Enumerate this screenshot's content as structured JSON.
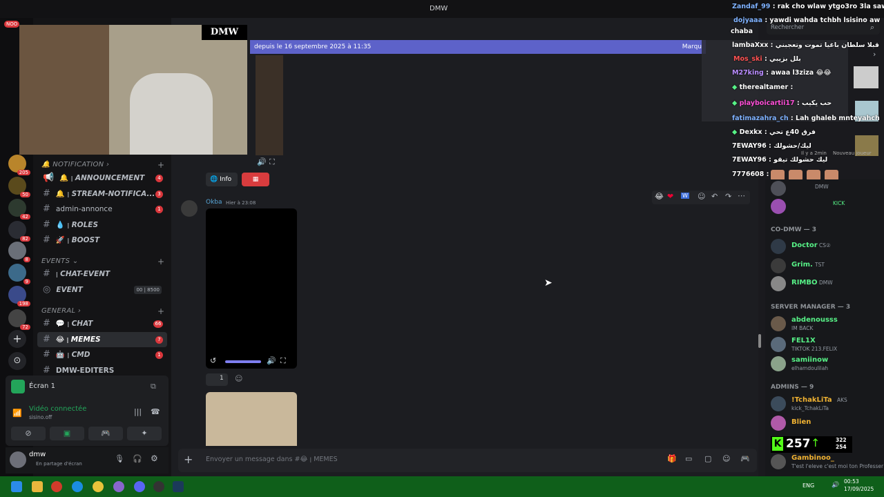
{
  "window": {
    "title": "DMW"
  },
  "overlay_logo": "DMW",
  "notif_badge": "NOO",
  "servers": [
    {
      "badge": ""
    },
    {
      "badge": "205"
    },
    {
      "badge": "50"
    },
    {
      "badge": "42"
    },
    {
      "badge": "82"
    },
    {
      "badge": "8"
    },
    {
      "badge": "9"
    },
    {
      "badge": "198"
    },
    {
      "badge": "72"
    }
  ],
  "channels": {
    "cat_notification": "NOTIFICATION",
    "announcement": {
      "prefix": "🔔 ꞁ",
      "label": "ANNOUNCEMENT",
      "badge": "4"
    },
    "stream_notif": {
      "prefix": "🔔 ꞁ",
      "label": "STREAM-NOTIFICA...",
      "badge": "3"
    },
    "admin_annonce": {
      "label": "admin-annonce",
      "badge": "1"
    },
    "roles": {
      "prefix": "💧 ꞁ",
      "label": "ROLES"
    },
    "boost": {
      "prefix": "🚀 ꞁ",
      "label": "BOOST"
    },
    "cat_events": "EVENTS",
    "chat_event": {
      "prefix": "ꞁ",
      "label": "CHAT-EVENT"
    },
    "event": {
      "label": "EVENT",
      "c1": "00",
      "c2": "8500"
    },
    "cat_general": "GENERAL",
    "chat": {
      "prefix": "💬 ꞁ",
      "label": "CHAT",
      "badge": "66"
    },
    "memes": {
      "prefix": "😂 ꞁ",
      "label": "MEMES",
      "badge": "7"
    },
    "cmd": {
      "prefix": "🤖 ꞁ",
      "label": "CMD",
      "badge": "1"
    },
    "editers": {
      "label": "DMW-EDITERS"
    }
  },
  "voice": {
    "screen": "Écran 1",
    "status": "Vidéo connectée",
    "server": "sisino.off"
  },
  "user": {
    "name": "dmw",
    "status": "En partage d'écran"
  },
  "banner": {
    "text": "depuis le 16 septembre 2025 à 11:35",
    "action": "Marqu"
  },
  "info_button": "Info",
  "message": {
    "author": "Okba",
    "time": "Hier à 23:08",
    "reaction_count": "1"
  },
  "composer": {
    "placeholder": "Envoyer un message dans #😂 ꞁ MEMES"
  },
  "search": {
    "placeholder": "Rechercher"
  },
  "overlay_chat": [
    {
      "user": "Zandaf_99",
      "text": ": rak cho wlaw ytgo3ro 3la sawa",
      "color": "#7fb2ff"
    },
    {
      "user": "dojyaaa",
      "text": ": yawdi wahda tchbh lsisino aw",
      "color": "#7fb2ff"
    },
    {
      "user": "chaba",
      "text": "",
      "color": "#ffffff"
    },
    {
      "user": "lambaXxx",
      "text": ": قبلا سلطان باغيا تموت وتعجبني",
      "color": "#ffffff"
    },
    {
      "user": "Mos_ski",
      "text": ": بلل بزيبي",
      "color": "#ff5252"
    },
    {
      "user": "M27king",
      "text": ": awaa l3ziza 😂😂",
      "color": "#b98cff"
    },
    {
      "user": "therealtamer",
      "text": ":",
      "color": "#ffffff"
    },
    {
      "user": "playboicartii17",
      "text": ": حب يكيب",
      "color": "#ff4fd8"
    },
    {
      "user": "fatimazahra_ch",
      "text": ": Lah ghaleb mnteyahch",
      "color": "#7fb2ff"
    },
    {
      "user": "Dexkx",
      "text": ": فرق 40ع تحي",
      "color": "#ffffff"
    },
    {
      "user": "7EWAY96",
      "text": ": ليك/حشولك",
      "color": "#ffffff"
    },
    {
      "user": "7EWAY96",
      "text": ": ليك حشولك تيقو",
      "color": "#ffffff"
    },
    {
      "user": "7776608",
      "text": ":",
      "color": "#ffffff"
    }
  ],
  "overlay_extra": {
    "ago": "Il y a 2min",
    "new_player": "Nouveau joueur",
    "kick": "KICK"
  },
  "members": {
    "top_status": "DMW",
    "co_dmw_header": "CO-DMW — 3",
    "co_dmw": [
      {
        "name": "Doctor",
        "tag": "CS②",
        "color": "#57f287"
      },
      {
        "name": "Grim.",
        "tag": "TST",
        "color": "#57f287"
      },
      {
        "name": "RIMBO",
        "tag": "DMW",
        "color": "#57f287"
      }
    ],
    "manager_header": "SERVER MANAGER — 3",
    "managers": [
      {
        "name": "abdenousss",
        "status": "IM BACK",
        "color": "#57f287"
      },
      {
        "name": "FEL1X",
        "status": "TIKTOK 213.FELIX",
        "color": "#57f287"
      },
      {
        "name": "samiinow",
        "status": "elhamdoulilah",
        "color": "#57f287"
      }
    ],
    "admins_header": "ADMINS — 9",
    "admins": [
      {
        "name": "!TchakLiTa",
        "status": "kick_TchakLiTa",
        "tag": "AKS",
        "color": "#f0b232"
      },
      {
        "name": "Blien",
        "status": "",
        "color": "#f0b232"
      },
      {
        "name": "Gambinoo_",
        "status": "T'est l'eleve c'est moi ton Professer",
        "color": "#f0b232"
      }
    ]
  },
  "kick_widget": {
    "count": "257",
    "a": "322",
    "b": "254"
  },
  "taskbar": {
    "lang": "ENG",
    "time": "00:53",
    "date": "17/09/2025"
  }
}
